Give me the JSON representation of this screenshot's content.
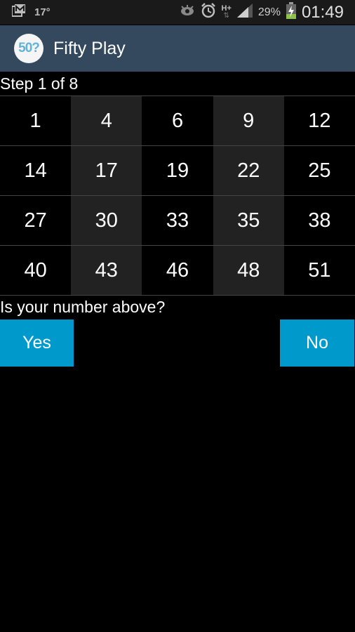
{
  "status_bar": {
    "icons_left": [
      "gallery-icon"
    ],
    "temperature": "17°",
    "icons_right": [
      "eye-icon",
      "alarm-icon",
      "network-hplus-icon",
      "signal-icon",
      "battery-charging-icon"
    ],
    "network_type": "H+",
    "battery_percent": "29%",
    "clock": "01:49"
  },
  "action_bar": {
    "logo_text": "50?",
    "title": "Fifty Play"
  },
  "game": {
    "step_label": "Step 1 of 8",
    "numbers": [
      [
        "1",
        "4",
        "6",
        "9",
        "12"
      ],
      [
        "14",
        "17",
        "19",
        "22",
        "25"
      ],
      [
        "27",
        "30",
        "33",
        "35",
        "38"
      ],
      [
        "40",
        "43",
        "46",
        "48",
        "51"
      ]
    ],
    "question": "Is your number above?",
    "yes_label": "Yes",
    "no_label": "No"
  },
  "colors": {
    "action_bar": "#34495e",
    "button": "#0099cc",
    "cell_dark": "#222222",
    "background": "#000000"
  }
}
